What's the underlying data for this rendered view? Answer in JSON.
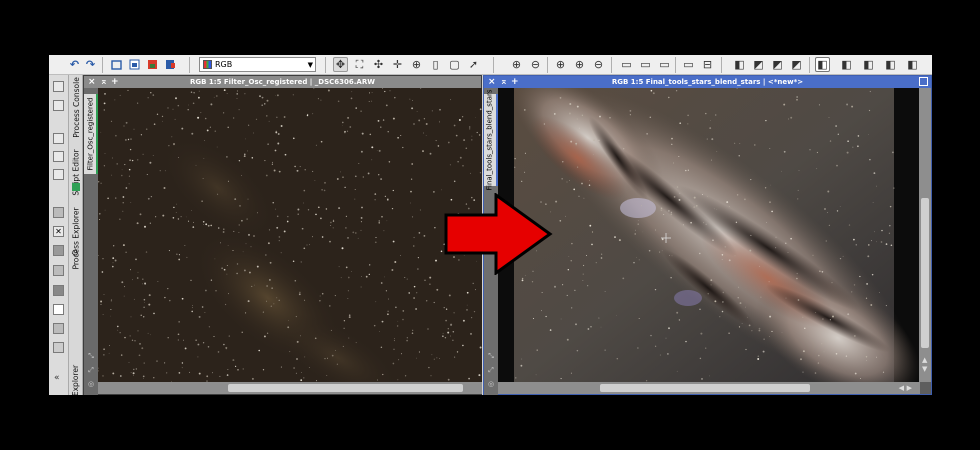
{
  "toolbar": {
    "color_mode": "RGB",
    "icons": [
      "undo-icon",
      "redo-icon",
      "new-image-icon",
      "open-icon",
      "save-icon",
      "export-icon",
      "rgb-select",
      "navigate-icon",
      "zoom-fit-icon",
      "pan-icon",
      "move-icon",
      "center-icon",
      "preview-icon",
      "pointer-icon",
      "zoom-in-icon",
      "zoom-out-icon",
      "zoom-1-icon",
      "zoom-in-alt-icon",
      "zoom-out-alt-icon",
      "fit-view-icon",
      "preview-a-icon",
      "preview-b-icon",
      "preview-c-icon",
      "screen-a-icon",
      "screen-b-icon",
      "stf-icon",
      "stf-link-icon",
      "stf-auto-icon",
      "stf-reset-icon",
      "mask-icon",
      "mask-a-icon",
      "mask-b-icon",
      "mask-c-icon"
    ]
  },
  "dock": {
    "tabs": [
      "Process Console",
      "Script Editor",
      "Process Explorer",
      "Explorer"
    ]
  },
  "window1": {
    "title": "RGB 1:5 Filter_Osc_registered | _DSC6306.ARW",
    "side_tab": "Filter_Osc_registered"
  },
  "window2": {
    "title": "RGB 1:5 Final_tools_stars_blend_stars | <*new*>",
    "side_tab": "Final_tools_stars_blend_stars"
  },
  "colors": {
    "active_title": "#4a6ec8",
    "inactive_title": "#8a8a8a",
    "arrow_fill": "#e60000"
  }
}
